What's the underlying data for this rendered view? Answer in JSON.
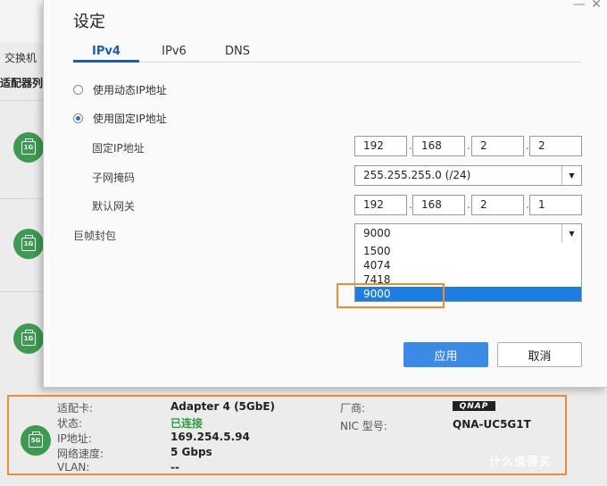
{
  "background": {
    "tab_label": "交换机",
    "section_heading": "适配器列",
    "adapter_badges": [
      "1G",
      "1G",
      "1G"
    ]
  },
  "dialog": {
    "title": "设定",
    "close_glyph": "✕",
    "minimize_glyph": "—",
    "tabs": [
      {
        "label": "IPv4",
        "active": true
      },
      {
        "label": "IPv6",
        "active": false
      },
      {
        "label": "DNS",
        "active": false
      }
    ],
    "radio_dynamic": "使用动态IP地址",
    "radio_static": "使用固定IP地址",
    "selected_radio": "static",
    "fields": {
      "static_ip": {
        "label": "固定IP地址",
        "octets": [
          "192",
          "168",
          "2",
          "2"
        ]
      },
      "subnet": {
        "label": "子网掩码",
        "value": "255.255.255.0 (/24)"
      },
      "gateway": {
        "label": "默认网关",
        "octets": [
          "192",
          "168",
          "2",
          "1"
        ]
      },
      "jumbo": {
        "label": "巨帧封包",
        "value": "9000"
      }
    },
    "octet_separator": ".",
    "jumbo_options": [
      "1500",
      "4074",
      "7418",
      "9000"
    ],
    "jumbo_selected_index": 3,
    "apply_label": "应用",
    "cancel_label": "取消"
  },
  "adapter_card": {
    "badge": "5G",
    "rows_left": [
      {
        "label": "适配卡:",
        "value": "Adapter 4 (5GbE)"
      },
      {
        "label": "状态:",
        "value": "已连接"
      },
      {
        "label": "IP地址:",
        "value": "169.254.5.94"
      },
      {
        "label": "网络速度:",
        "value": "5 Gbps"
      },
      {
        "label": "VLAN:",
        "value": "--"
      }
    ],
    "vendor_label": "厂商:",
    "vendor_logo": "QNAP",
    "nic_label": "NIC 型号:",
    "nic_value": "QNA-UC5G1T",
    "status_color": "#2e9a3e"
  },
  "watermark": "什么值得买",
  "colors": {
    "accent": "#1e5ea8",
    "primary_button": "#3b8ae6",
    "highlight": "#f08b37",
    "badge_green": "#3e9a52"
  }
}
